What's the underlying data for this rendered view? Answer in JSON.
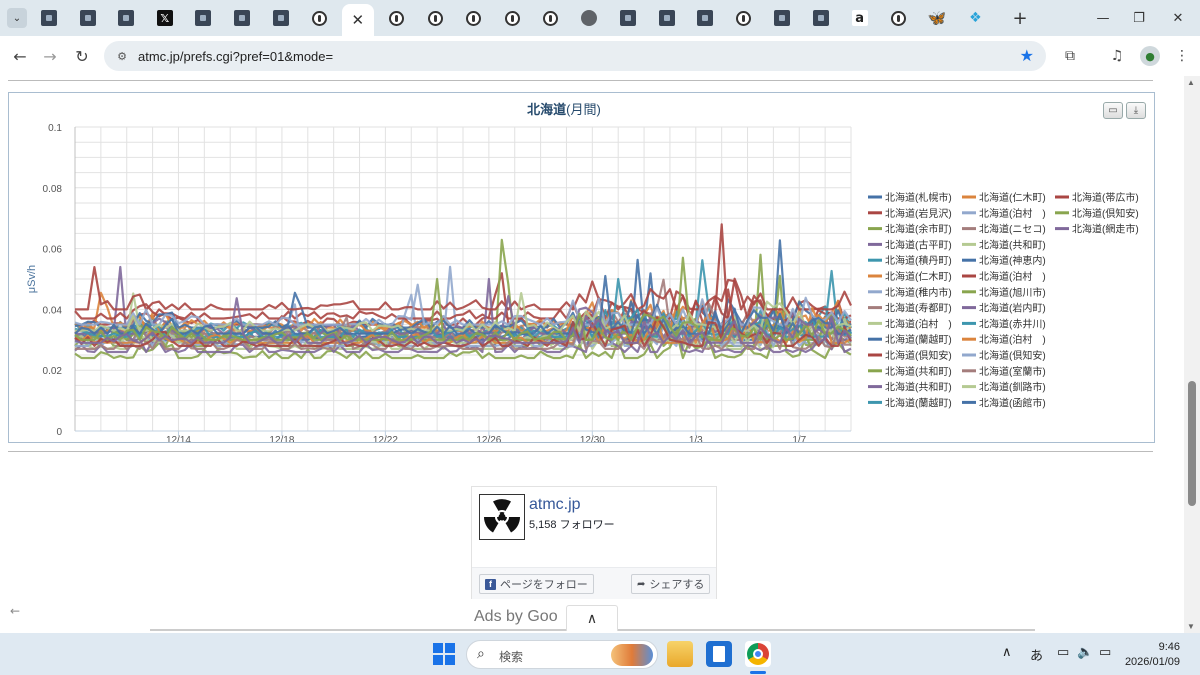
{
  "browser": {
    "url": "atmc.jp/prefs.cgi?pref=01&mode=",
    "tab_favicons": [
      "site",
      "site",
      "site",
      "x",
      "site",
      "site",
      "site",
      "circle",
      "active",
      "circle",
      "circle",
      "circle",
      "circle",
      "circle",
      "globe",
      "site",
      "site",
      "site",
      "circle",
      "site",
      "site",
      "amazon",
      "circle",
      "butterfly",
      "puzzle"
    ],
    "x_glyph": "𝕏",
    "amazon_glyph": "a",
    "butterfly_glyph": "🦋",
    "puzzle_glyph": "❖",
    "close_glyph": "✕",
    "new_tab_glyph": "+",
    "dropdown_glyph": "⌄",
    "minimize_glyph": "—",
    "restore_glyph": "❐",
    "close_window_glyph": "✕",
    "back_glyph": "←",
    "forward_glyph": "→",
    "reload_glyph": "↻",
    "star_glyph": "★",
    "extensions_glyph": "⧉",
    "media_glyph": "♫",
    "profile_glyph": "●",
    "menu_glyph": "⋮",
    "site_info_glyph": "⚙"
  },
  "chart_buttons": {
    "print_glyph": "▭",
    "download_glyph": "⤓"
  },
  "chart_data": {
    "type": "line",
    "title": "北海道",
    "title_suffix": "(月間)",
    "ylabel": "μSv/h",
    "ylim": [
      0,
      0.1
    ],
    "y_ticks": [
      "0",
      "0.02",
      "0.04",
      "0.06",
      "0.08",
      "0.1"
    ],
    "x_ticks": [
      "12/14",
      "12/18",
      "12/22",
      "12/26",
      "12/30",
      "1/3",
      "1/7"
    ],
    "x_domain_days": [
      0,
      30
    ],
    "x_tick_days": [
      4,
      8,
      12,
      16,
      20,
      24,
      28
    ],
    "legend_position": "right",
    "grid": true,
    "series": [
      {
        "name": "北海道(札幌市)",
        "color": "#4572a7",
        "base": 0.031,
        "spikes": [
          [
            27.3,
            0.072
          ],
          [
            22.2,
            0.058
          ]
        ]
      },
      {
        "name": "北海道(岩見沢)",
        "color": "#aa4643",
        "base": 0.035,
        "spikes": [
          [
            16.4,
            0.066
          ],
          [
            25.0,
            0.068
          ]
        ]
      },
      {
        "name": "北海道(余市町)",
        "color": "#89a54e",
        "base": 0.028,
        "spikes": [
          [
            16.6,
            0.092
          ],
          [
            26.5,
            0.058
          ]
        ]
      },
      {
        "name": "北海道(古平町)",
        "color": "#80699b",
        "base": 0.03,
        "spikes": [
          [
            1.7,
            0.061
          ]
        ]
      },
      {
        "name": "北海道(積丹町)",
        "color": "#3d96ae",
        "base": 0.033,
        "spikes": [
          [
            24.2,
            0.063
          ]
        ]
      },
      {
        "name": "北海道(仁木町)",
        "color": "#db843d",
        "base": 0.034,
        "spikes": [
          [
            1.1,
            0.055
          ]
        ]
      },
      {
        "name": "北海道(稚内市)",
        "color": "#92a8cd",
        "base": 0.029,
        "spikes": [
          [
            12.9,
            0.058
          ],
          [
            14.5,
            0.054
          ]
        ]
      },
      {
        "name": "北海道(寿都町)",
        "color": "#a47d7c",
        "base": 0.032,
        "spikes": [
          [
            22.8,
            0.055
          ]
        ]
      },
      {
        "name": "北海道(泊村　)",
        "color": "#b5ca92",
        "base": 0.027,
        "spikes": [
          [
            27.9,
            0.056
          ]
        ]
      },
      {
        "name": "北海道(蘭越町)",
        "color": "#4572a7",
        "base": 0.03,
        "spikes": [
          [
            21.8,
            0.064
          ]
        ]
      },
      {
        "name": "北海道(倶知安)",
        "color": "#aa4643",
        "base": 0.037,
        "spikes": [
          [
            25.6,
            0.061
          ]
        ]
      },
      {
        "name": "北海道(共和町)",
        "color": "#89a54e",
        "base": 0.024,
        "spikes": [
          [
            27.2,
            0.059
          ]
        ]
      },
      {
        "name": "北海道(共和町)",
        "color": "#80699b",
        "base": 0.026,
        "spikes": [
          [
            16.0,
            0.05
          ]
        ]
      },
      {
        "name": "北海道(蘭越町)",
        "color": "#3d96ae",
        "base": 0.031,
        "spikes": [
          [
            29.2,
            0.059
          ]
        ]
      },
      {
        "name": "北海道(仁木町)",
        "color": "#db843d",
        "base": 0.033,
        "spikes": [
          [
            29.4,
            0.051
          ]
        ]
      },
      {
        "name": "北海道(泊村　)",
        "color": "#92a8cd",
        "base": 0.028,
        "spikes": [
          [
            8.4,
            0.053
          ]
        ]
      },
      {
        "name": "北海道(ニセコ)",
        "color": "#a47d7c",
        "base": 0.03,
        "spikes": [
          [
            24.6,
            0.052
          ]
        ]
      },
      {
        "name": "北海道(共和町)",
        "color": "#b5ca92",
        "base": 0.029,
        "spikes": [
          [
            2.2,
            0.05
          ]
        ]
      },
      {
        "name": "北海道(神恵内)",
        "color": "#4572a7",
        "base": 0.034,
        "spikes": [
          [
            8.6,
            0.055
          ]
        ]
      },
      {
        "name": "北海道(泊村　)",
        "color": "#aa4643",
        "base": 0.04,
        "spikes": [
          [
            0.8,
            0.058
          ]
        ]
      },
      {
        "name": "北海道(旭川市)",
        "color": "#89a54e",
        "base": 0.03,
        "spikes": [
          [
            23.5,
            0.057
          ]
        ]
      },
      {
        "name": "北海道(岩内町)",
        "color": "#80699b",
        "base": 0.032,
        "spikes": [
          [
            16.8,
            0.048
          ]
        ]
      },
      {
        "name": "北海道(赤井川)",
        "color": "#3d96ae",
        "base": 0.031,
        "spikes": [
          [
            21.0,
            0.05
          ]
        ]
      },
      {
        "name": "北海道(泊村　)",
        "color": "#db843d",
        "base": 0.029,
        "spikes": [
          [
            28.6,
            0.05
          ]
        ]
      },
      {
        "name": "北海道(倶知安)",
        "color": "#92a8cd",
        "base": 0.035,
        "spikes": [
          [
            13.2,
            0.052
          ]
        ]
      },
      {
        "name": "北海道(室蘭市)",
        "color": "#a47d7c",
        "base": 0.027,
        "spikes": [
          [
            10.4,
            0.046
          ]
        ]
      },
      {
        "name": "北海道(釧路市)",
        "color": "#b5ca92",
        "base": 0.033,
        "spikes": [
          [
            17.3,
            0.049
          ]
        ]
      },
      {
        "name": "北海道(函館市)",
        "color": "#4572a7",
        "base": 0.032,
        "spikes": [
          [
            20.5,
            0.051
          ]
        ]
      },
      {
        "name": "北海道(帯広市)",
        "color": "#aa4643",
        "base": 0.028,
        "spikes": [
          [
            25.2,
            0.052
          ]
        ]
      },
      {
        "name": "北海道(倶知安)",
        "color": "#89a54e",
        "base": 0.03,
        "spikes": [
          [
            14.0,
            0.05
          ]
        ]
      },
      {
        "name": "北海道(網走市)",
        "color": "#80699b",
        "base": 0.029,
        "spikes": [
          [
            6.2,
            0.048
          ]
        ]
      }
    ]
  },
  "fb_widget": {
    "name": "atmc.jp",
    "followers": "5,158 フォロワー",
    "follow_label": "ページをフォロー",
    "share_label": "シェアする",
    "follow_glyph": "f",
    "share_glyph": "➦"
  },
  "ads": {
    "text": "Ads by Goo",
    "collapse_glyph": "∧",
    "back_glyph": "←"
  },
  "taskbar": {
    "search_label": "検索",
    "search_glyph": "⌕",
    "tray_up_glyph": "∧",
    "ime_label": "あ",
    "network_glyph": "▭",
    "volume_glyph": "🔈",
    "battery_glyph": "▭",
    "time": "9:46",
    "date": "2026/01/09"
  }
}
